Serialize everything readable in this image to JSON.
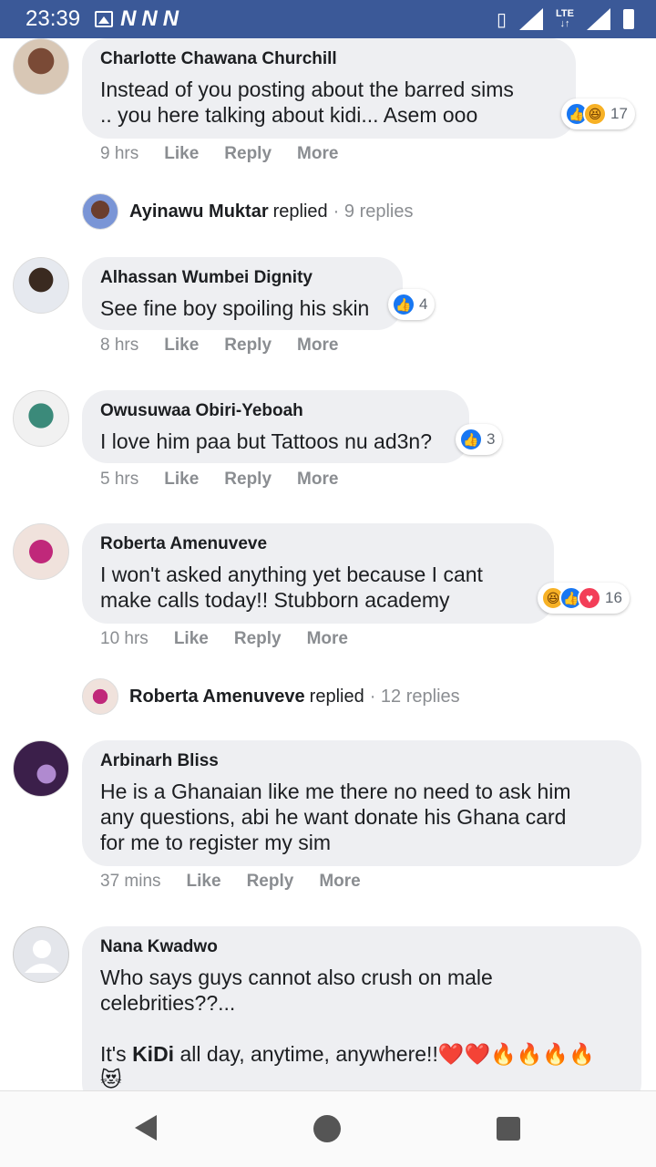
{
  "status_bar": {
    "time": "23:39",
    "icons": [
      "image-icon",
      "n-icon",
      "n-icon",
      "n-icon",
      "vibrate-icon",
      "signal-x-icon",
      "lte-icon",
      "signal-icon",
      "battery-icon"
    ],
    "n_label": "N",
    "lte_label": "LTE"
  },
  "comments": [
    {
      "name": "Charlotte Chawana Churchill",
      "text_lines": [
        "Instead of you posting about the barred sims",
        ".. you here talking about kidi... Asem ooo"
      ],
      "time": "9 hrs",
      "reaction_count": "17",
      "reactions": [
        "like",
        "haha"
      ]
    },
    {
      "name": "Alhassan Wumbei Dignity",
      "text_lines": [
        "See fine boy spoiling his skin"
      ],
      "time": "8 hrs",
      "reaction_count": "4",
      "reactions": [
        "like"
      ]
    },
    {
      "name": "Owusuwaa Obiri-Yeboah",
      "text_lines": [
        "I love him paa but Tattoos nu ad3n?"
      ],
      "time": "5 hrs",
      "reaction_count": "3",
      "reactions": [
        "like"
      ]
    },
    {
      "name": "Roberta Amenuveve",
      "text_lines": [
        "I won't asked anything yet because I cant",
        "make calls today!! Stubborn academy"
      ],
      "time": "10 hrs",
      "reaction_count": "16",
      "reactions": [
        "haha",
        "like",
        "love"
      ]
    },
    {
      "name": "Arbinarh Bliss",
      "text_lines": [
        "He is a Ghanaian like me there no need to ask him",
        "any questions, abi he want donate his Ghana card",
        "for me to register my sim"
      ],
      "time": "37 mins"
    },
    {
      "name": "Nana Kwadwo",
      "text_lines": [
        "Who says guys cannot also crush on male",
        "celebrities??..."
      ],
      "text_last_prefix": "It's ",
      "text_last_bold": "KiDi",
      "text_last_suffix": " all day, anytime, anywhere!!❤️❤️🔥🔥🔥🔥",
      "text_emoji_line": "😻"
    }
  ],
  "actions": {
    "like": "Like",
    "reply": "Reply",
    "more": "More"
  },
  "replies": [
    {
      "name": "Ayinawu Muktar",
      "verb": "replied",
      "count": "· 9 replies"
    },
    {
      "name": "Roberta Amenuveve",
      "verb": "replied",
      "count": "· 12 replies"
    }
  ],
  "colors": {
    "status_bar": "#3b5998",
    "bubble": "#eeeff2",
    "like_blue": "#1877f2",
    "meta_gray": "#8a8d91"
  }
}
